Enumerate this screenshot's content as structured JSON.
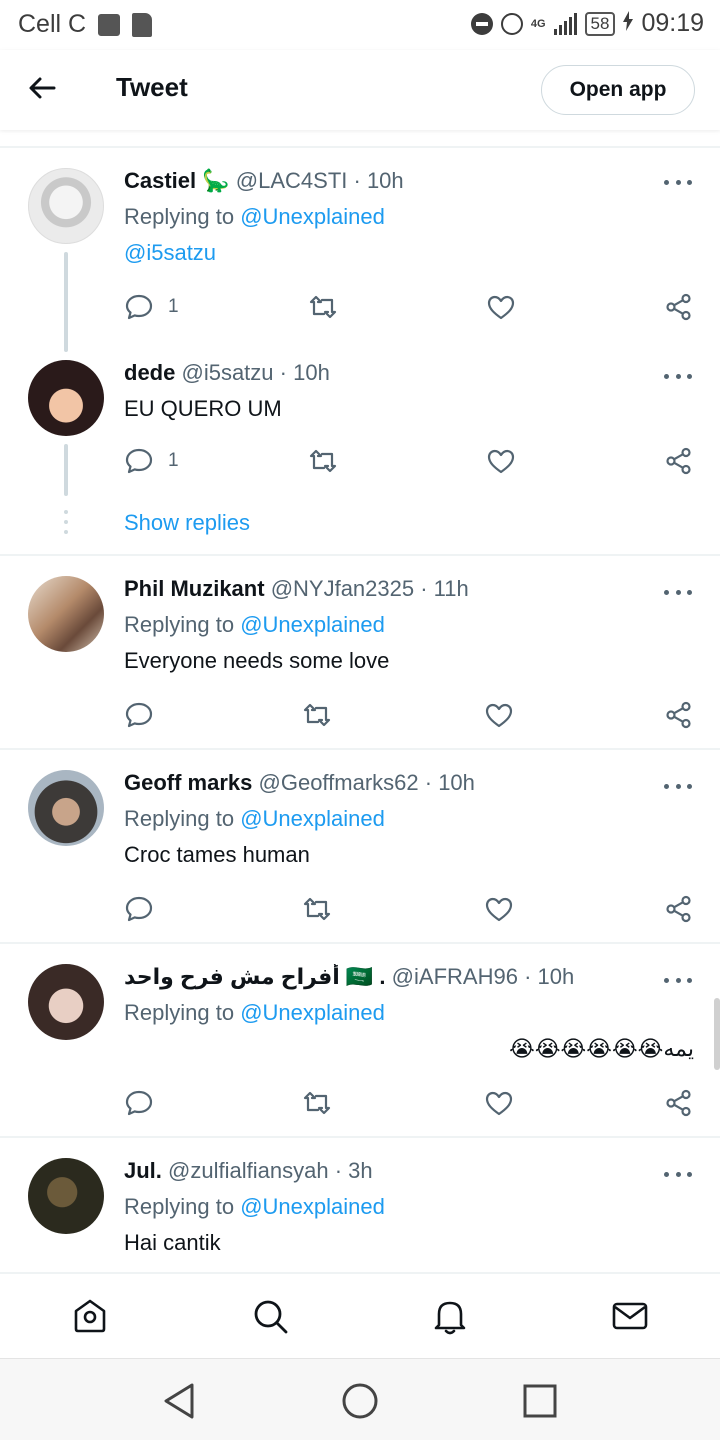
{
  "status_bar": {
    "carrier": "Cell C",
    "network": "4G",
    "battery": "58",
    "time": "09:19"
  },
  "header": {
    "back_icon": "arrow-left-icon",
    "title": "Tweet",
    "open_app_label": "Open app"
  },
  "tweets": [
    {
      "name": "Castiel 🦕",
      "handle": "@LAC4STI",
      "time": "· 10h",
      "replying_label": "Replying to",
      "replying_to": "@Unexplained",
      "mention_line": "@i5satzu",
      "reply_count": "1"
    },
    {
      "name": "dede",
      "handle": "@i5satzu",
      "time": "· 10h",
      "text": "EU QUERO UM",
      "reply_count": "1",
      "show_replies": "Show replies"
    },
    {
      "name": "Phil Muzikant",
      "handle": "@NYJfan2325",
      "time": "· 11h",
      "replying_label": "Replying to",
      "replying_to": "@Unexplained",
      "text": "Everyone needs some love"
    },
    {
      "name": "Geoff marks",
      "handle": "@Geoffmarks62",
      "time": "· 10h",
      "replying_label": "Replying to",
      "replying_to": "@Unexplained",
      "text": "Croc tames human"
    },
    {
      "name": "أفراح مش فرح واحد 🇸🇦 .",
      "handle": "@iAFRAH96",
      "time": "· 10h",
      "replying_label": "Replying to",
      "replying_to": "@Unexplained",
      "text": "يمه😭😭😭😭😭😭"
    },
    {
      "name": "Jul.",
      "handle": "@zulfialfiansyah",
      "time": "· 3h",
      "replying_label": "Replying to",
      "replying_to": "@Unexplained",
      "text": "Hai cantik"
    }
  ],
  "colors": {
    "link": "#1d9bf0",
    "secondary_text": "#536471",
    "divider": "#eff3f4"
  },
  "bottom_nav": [
    "home-icon",
    "search-icon",
    "notifications-icon",
    "messages-icon"
  ],
  "system_nav": [
    "back-triangle-icon",
    "home-circle-icon",
    "recents-square-icon"
  ]
}
